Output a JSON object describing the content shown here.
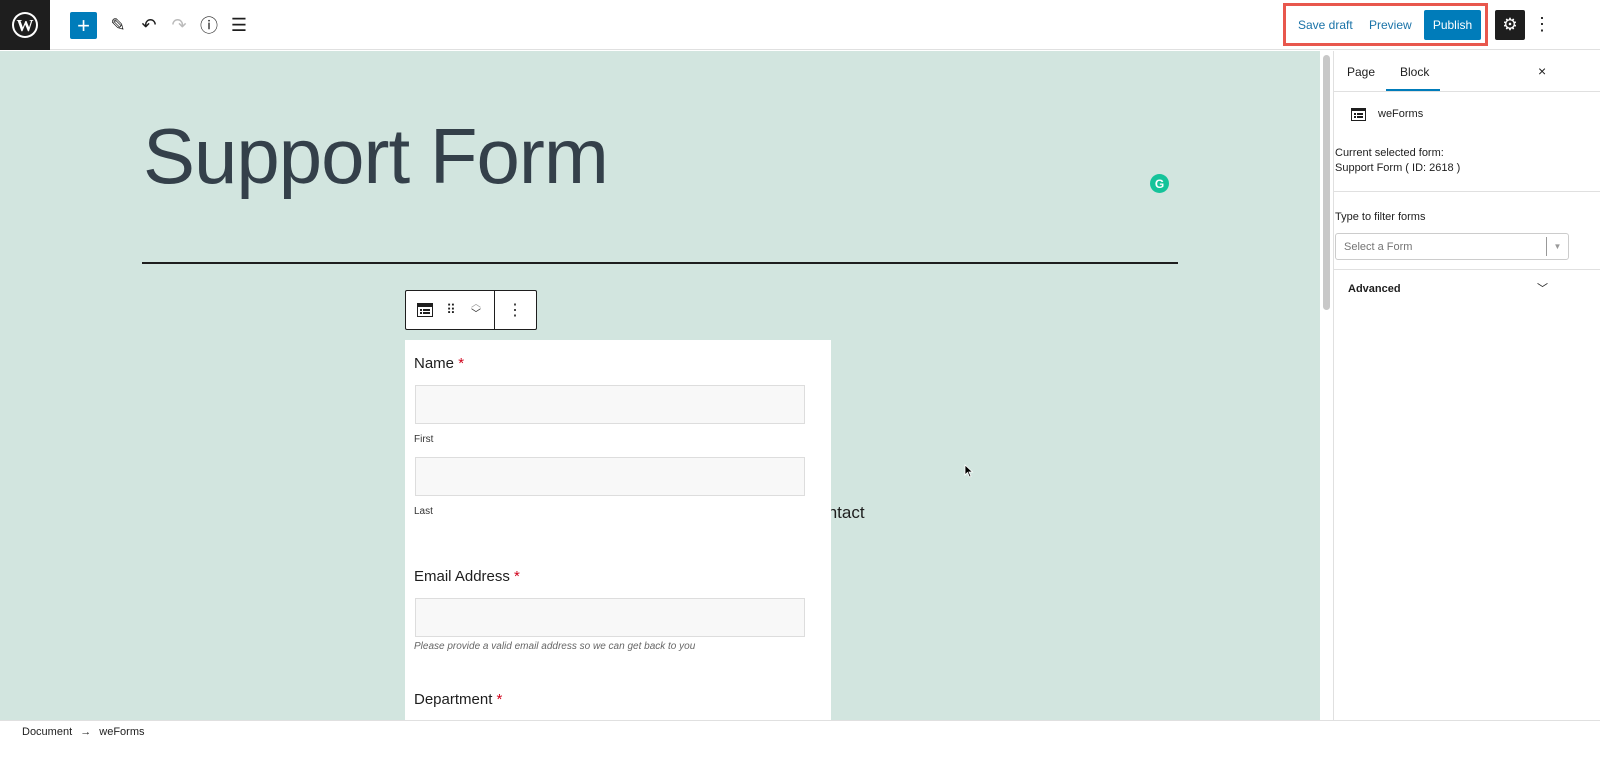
{
  "toolbar": {
    "save_draft": "Save draft",
    "preview": "Preview",
    "publish": "Publish",
    "icons": [
      "wordpress-logo",
      "plus",
      "pencil",
      "undo",
      "redo",
      "info",
      "list-view",
      "gear",
      "more-vertical"
    ],
    "accent": "#007cba"
  },
  "editor": {
    "title": "Support Form",
    "partial_text": "Contact",
    "grammarly": "G"
  },
  "form": {
    "name_label": "Name",
    "required": "*",
    "first": "First",
    "last": "Last",
    "email_label": "Email Address",
    "email_help": "Please provide a valid email address so we can get back to you",
    "department_label": "Department"
  },
  "sidebar": {
    "tabs": [
      "Page",
      "Block"
    ],
    "active_tab": "Block",
    "close": "×",
    "block_name": "weForms",
    "current_label": "Current selected form:",
    "current_value": "Support Form ( ID: 2618 )",
    "filter_label": "Type to filter forms",
    "select_placeholder": "Select a Form",
    "select_arrow": "▼",
    "advanced": "Advanced"
  },
  "footer": {
    "breadcrumb": [
      "Document",
      "weForms"
    ],
    "separator": "→"
  }
}
